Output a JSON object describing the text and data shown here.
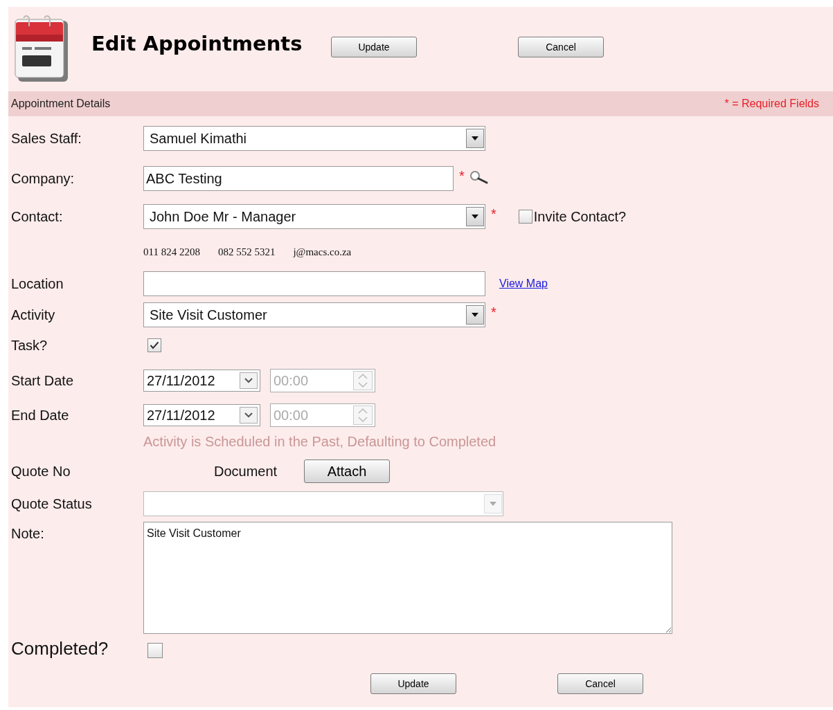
{
  "header": {
    "title": "Edit Appointments",
    "buttons": [
      "Update",
      "Cancel"
    ]
  },
  "section": {
    "title": "Appointment Details",
    "required_note": "* = Required Fields"
  },
  "fields": [
    {
      "kind": "select",
      "label": "Sales Staff:",
      "value": "Samuel Kimathi"
    },
    {
      "kind": "lookup",
      "label": "Company:",
      "value": "ABC Testing",
      "required_mark": "*"
    },
    {
      "kind": "select",
      "label": "Contact:",
      "value": "John Doe Mr - Manager",
      "required_mark": "*",
      "invite": {
        "label": "Invite Contact?",
        "checked": false
      }
    },
    {
      "kind": "info",
      "items": [
        "011 824 2208",
        "082 552 5321",
        "j@macs.co.za"
      ]
    },
    {
      "kind": "text",
      "label": "Location",
      "link": "View Map"
    },
    {
      "kind": "select",
      "label": "Activity",
      "value": "Site Visit Customer",
      "required_mark": "*"
    },
    {
      "kind": "checkbox",
      "label": "Task?",
      "checked": true
    },
    {
      "kind": "datetime",
      "label": "Start Date",
      "date": "27/11/2012",
      "time": "00:00"
    },
    {
      "kind": "datetime",
      "label": "End Date",
      "date": "27/11/2012",
      "time": "00:00"
    },
    {
      "kind": "notice",
      "text": "Activity is Scheduled in the Past, Defaulting to Completed"
    },
    {
      "kind": "quote",
      "label": "Quote No",
      "document_label": "Document",
      "button": "Attach"
    },
    {
      "kind": "select",
      "label": "Quote Status",
      "disabled": true
    },
    {
      "kind": "textarea",
      "label": "Note:",
      "value": "Site Visit Customer"
    },
    {
      "kind": "bigcheckbox",
      "label": "Completed?",
      "checked": false
    }
  ],
  "footer": {
    "buttons": [
      "Update",
      "Cancel"
    ]
  }
}
